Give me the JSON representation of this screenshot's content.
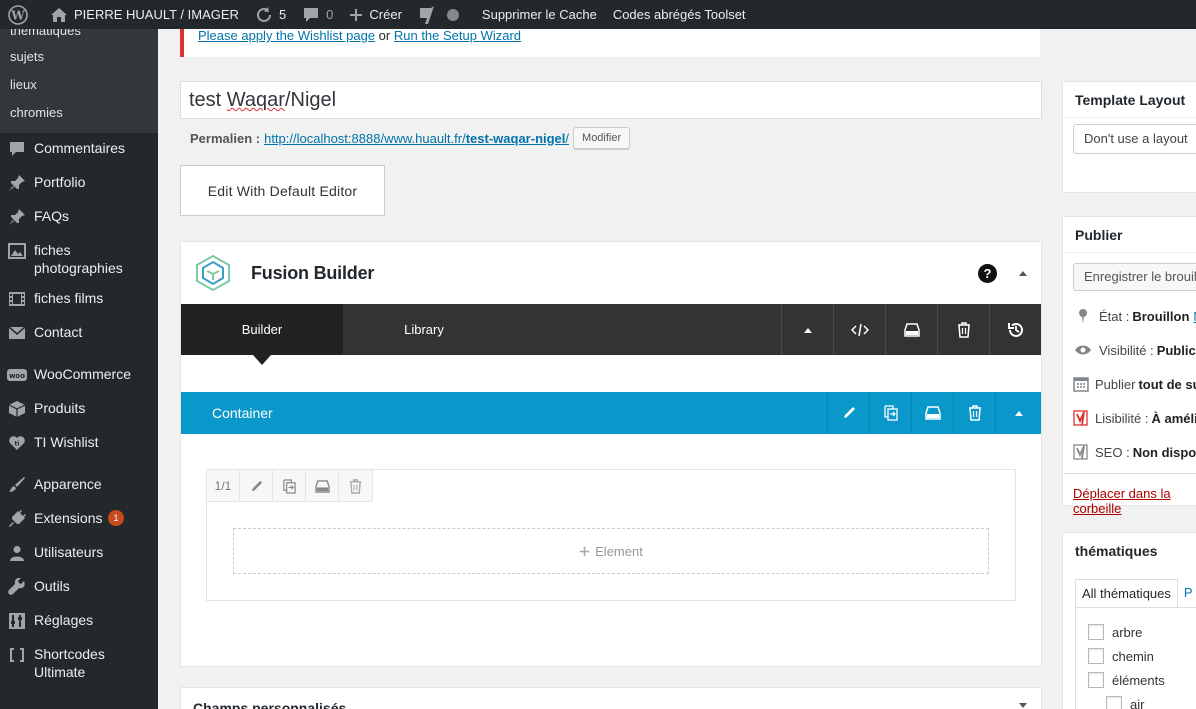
{
  "adminbar": {
    "site_name": "PIERRE HUAULT / IMAGER",
    "updates_count": "5",
    "comments_count": "0",
    "new_label": "Créer",
    "clear_cache": "Supprimer le Cache",
    "toolset_shortcodes": "Codes abrégés Toolset"
  },
  "sidebar": {
    "subitems": [
      "thématiques",
      "sujets",
      "lieux",
      "chromies"
    ],
    "items": [
      {
        "label": "Commentaires",
        "icon": "comment-icon"
      },
      {
        "label": "Portfolio",
        "icon": "pin-icon"
      },
      {
        "label": "FAQs",
        "icon": "pin-icon"
      },
      {
        "label": "fiches photographies",
        "icon": "image-icon"
      },
      {
        "label": "fiches films",
        "icon": "film-icon"
      },
      {
        "label": "Contact",
        "icon": "mail-icon"
      },
      {
        "label": "WooCommerce",
        "icon": "woo-icon"
      },
      {
        "label": "Produits",
        "icon": "box-icon"
      },
      {
        "label": "TI Wishlist",
        "icon": "heart-icon"
      },
      {
        "label": "Apparence",
        "icon": "brush-icon"
      },
      {
        "label": "Extensions",
        "icon": "plugin-icon",
        "badge": "1"
      },
      {
        "label": "Utilisateurs",
        "icon": "user-icon"
      },
      {
        "label": "Outils",
        "icon": "wrench-icon"
      },
      {
        "label": "Réglages",
        "icon": "sliders-icon"
      },
      {
        "label": "Shortcodes Ultimate",
        "icon": "brackets-icon"
      }
    ]
  },
  "notice": {
    "link1": "Please apply the Wishlist page",
    "or": "or",
    "link2": "Run the Setup Wizard"
  },
  "editor": {
    "title_part1": "test ",
    "title_part2": "Waqar",
    "title_part3": "/Nigel",
    "permalink_label": "Permalien :",
    "permalink_base": "http://localhost:8888/www.huault.fr/",
    "permalink_slug": "test-waqar-nigel",
    "permalink_end": "/",
    "modify_button": "Modifier",
    "default_editor_button": "Edit With Default Editor"
  },
  "fusion": {
    "title": "Fusion Builder",
    "help": "?",
    "tab_builder": "Builder",
    "tab_library": "Library",
    "container_label": "Container",
    "column_size": "1/1",
    "add_element": "Element"
  },
  "custom_fields": {
    "title": "Champs personnalisés"
  },
  "template_layout": {
    "title": "Template Layout",
    "select_value": "Don't use a layout"
  },
  "publish": {
    "title": "Publier",
    "save_draft": "Enregistrer le brouillon",
    "status_label": "État :",
    "status_value": "Brouillon",
    "status_link": "M",
    "visibility_label": "Visibilité :",
    "visibility_value": "Public",
    "publish_label": "Publier",
    "publish_value": "tout de suite",
    "readability_label": "Lisibilité :",
    "readability_value": "À améliorer",
    "seo_label": "SEO :",
    "seo_value": "Non disponible",
    "trash_link": "Déplacer dans la corbeille"
  },
  "thematiques": {
    "title": "thématiques",
    "tab_all": "All thématiques",
    "tab_other": "P",
    "terms": [
      "arbre",
      "chemin",
      "éléments",
      "air"
    ]
  },
  "colors": {
    "adminbar": "#23282d",
    "fusion_blue": "#0a97c9",
    "link": "#0073aa",
    "notice_red": "#dc3232"
  }
}
